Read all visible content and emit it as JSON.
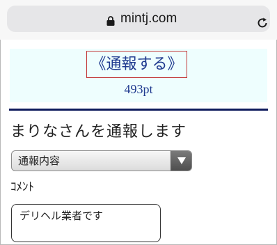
{
  "browser": {
    "url": "mintj.com",
    "lock_icon": "lock-icon",
    "reload_icon": "reload-icon"
  },
  "report": {
    "link_label": "《通報する》",
    "points": "493pt",
    "link_color": "#1f3a8f",
    "border_color": "#c33a3a",
    "box_background": "#eefefe"
  },
  "form": {
    "heading": "まりなさんを通報します",
    "reason_select_value": "通報内容",
    "comment_label": "ｺﾒﾝﾄ",
    "comment_value": "デリヘル業者です"
  }
}
